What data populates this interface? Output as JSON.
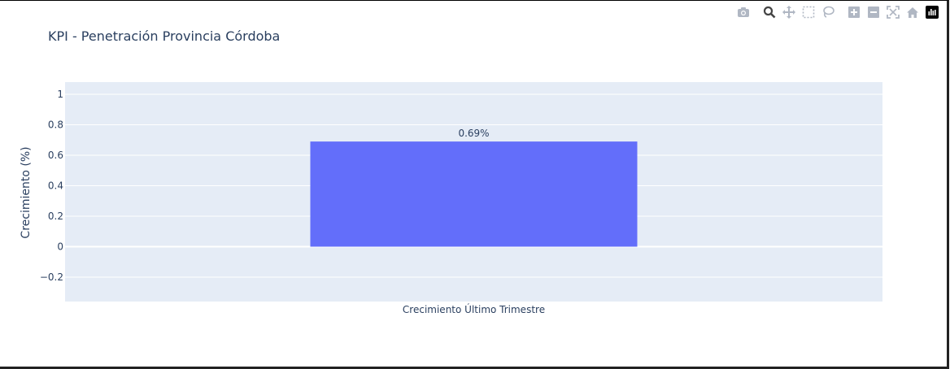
{
  "chart_data": {
    "type": "bar",
    "title": "KPI - Penetración Provincia Córdoba",
    "categories": [
      "Crecimiento Último Trimestre"
    ],
    "values": [
      0.69
    ],
    "value_labels": [
      "0.69%"
    ],
    "xlabel": "",
    "ylabel": "Crecimiento (%)",
    "ylim": [
      -0.36,
      1.08
    ],
    "yticks": [
      -0.2,
      0,
      0.2,
      0.4,
      0.6,
      0.8,
      1
    ],
    "ytick_labels": [
      "−0.2",
      "0",
      "0.2",
      "0.4",
      "0.6",
      "0.8",
      "1"
    ],
    "grid": true,
    "colors": {
      "bar": "#636efa",
      "plot_bg": "#e5ecf6",
      "grid": "#ffffff",
      "text": "#2a3f5f"
    }
  },
  "modebar": {
    "icons": [
      "camera-icon",
      "zoom-icon",
      "pan-icon",
      "box-select-icon",
      "lasso-select-icon",
      "zoom-in-icon",
      "zoom-out-icon",
      "autoscale-icon",
      "reset-axes-icon",
      "plotly-logo-icon"
    ]
  }
}
